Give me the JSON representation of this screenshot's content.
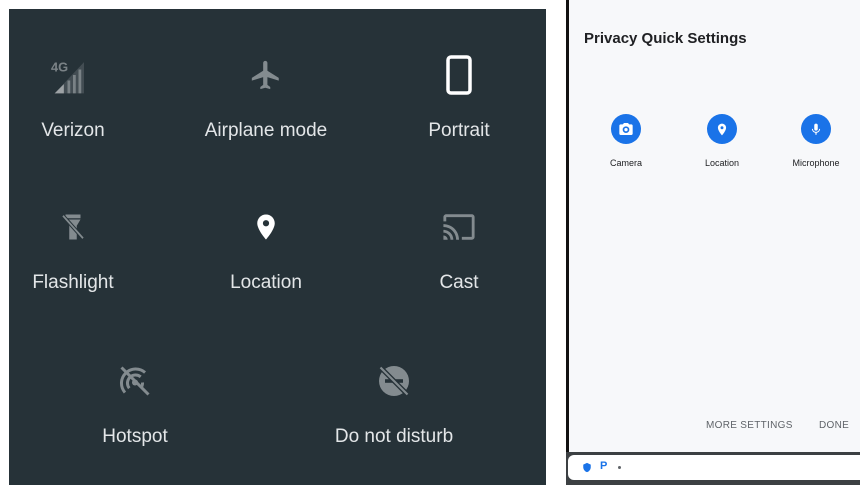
{
  "quick_settings": {
    "tiles": [
      {
        "label": "Verizon",
        "icon": "signal-4g-icon"
      },
      {
        "label": "Airplane mode",
        "icon": "airplane-icon"
      },
      {
        "label": "Portrait",
        "icon": "portrait-phone-icon"
      },
      {
        "label": "Flashlight",
        "icon": "flashlight-icon"
      },
      {
        "label": "Location",
        "icon": "location-pin-icon"
      },
      {
        "label": "Cast",
        "icon": "cast-icon"
      },
      {
        "label": "Hotspot",
        "icon": "hotspot-icon"
      },
      {
        "label": "Do not disturb",
        "icon": "do-not-disturb-icon"
      }
    ],
    "network_badge": "4G",
    "colors": {
      "background": "#263238",
      "text": "#e3e6e8",
      "icon_active": "#ffffff"
    }
  },
  "privacy_panel": {
    "title": "Privacy Quick Settings",
    "tiles": [
      {
        "label": "Camera",
        "icon": "camera-icon"
      },
      {
        "label": "Location",
        "icon": "location-pin-icon"
      },
      {
        "label": "Microphone",
        "icon": "microphone-icon"
      }
    ],
    "more_settings_label": "MORE SETTINGS",
    "done_label": "DONE",
    "status_bar": {
      "app_letter": "P"
    },
    "colors": {
      "accent": "#1a73e8",
      "panel": "#f7f8fa"
    }
  }
}
